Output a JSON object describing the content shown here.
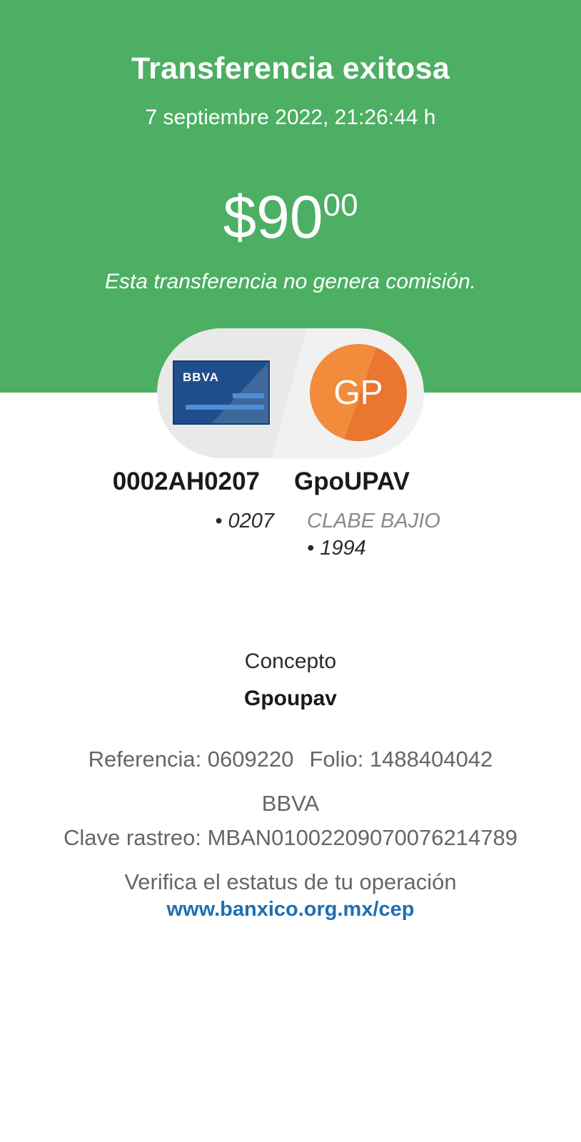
{
  "header": {
    "title": "Transferencia exitosa",
    "datetime": "7 septiembre 2022, 21:26:44 h",
    "amount_main": "$90",
    "amount_cents": "00",
    "commission_note": "Esta transferencia no genera comisión."
  },
  "colors": {
    "hero_green": "#4caf63",
    "card_blue": "#1f4e8c",
    "avatar_orange": "#f28b3b",
    "link_blue": "#1d6fb3"
  },
  "origin": {
    "card_brand": "BBVA",
    "card_icon": "bank-card-icon",
    "account_name": "0002AH0207",
    "account_suffix": "• 0207"
  },
  "destination": {
    "avatar_initials": "GP",
    "account_name": "GpoUPAV",
    "account_type": "CLABE BAJIO",
    "account_suffix": "• 1994"
  },
  "details": {
    "concept_label": "Concepto",
    "concept_value": "Gpoupav",
    "reference": "Referencia: 0609220",
    "folio": "Folio: 1488404042",
    "bank": "BBVA",
    "tracking_key": "Clave rastreo: MBAN01002209070076214789",
    "verify_text": "Verifica el estatus de tu operación",
    "verify_link": "www.banxico.org.mx/cep"
  }
}
